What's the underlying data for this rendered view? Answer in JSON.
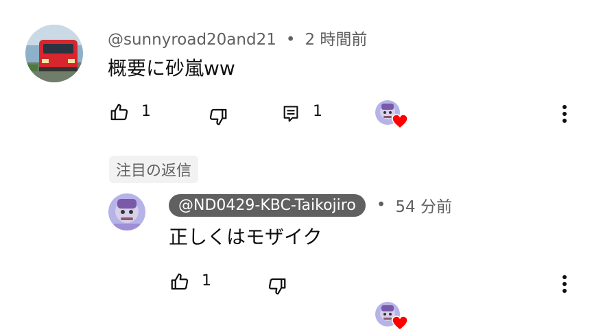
{
  "comment": {
    "author": "@sunnyroad20and21",
    "separator": "•",
    "time": "2 時間前",
    "text": "概要に砂嵐ww",
    "like_count": "1",
    "reply_count": "1"
  },
  "pinned_label": "注目の返信",
  "reply": {
    "author": "@ND0429-KBC-Taikojiro",
    "separator": "•",
    "time": "54 分前",
    "text": "正しくはモザイク",
    "like_count": "1"
  },
  "colors": {
    "heart": "#ff0000",
    "meta_text": "#606060",
    "chip_bg": "#f2f2f2",
    "handle_chip_bg": "#606060"
  },
  "icons": [
    "thumb-up-icon",
    "thumb-down-icon",
    "reply-icon",
    "creator-heart-icon",
    "more-vert-icon"
  ]
}
